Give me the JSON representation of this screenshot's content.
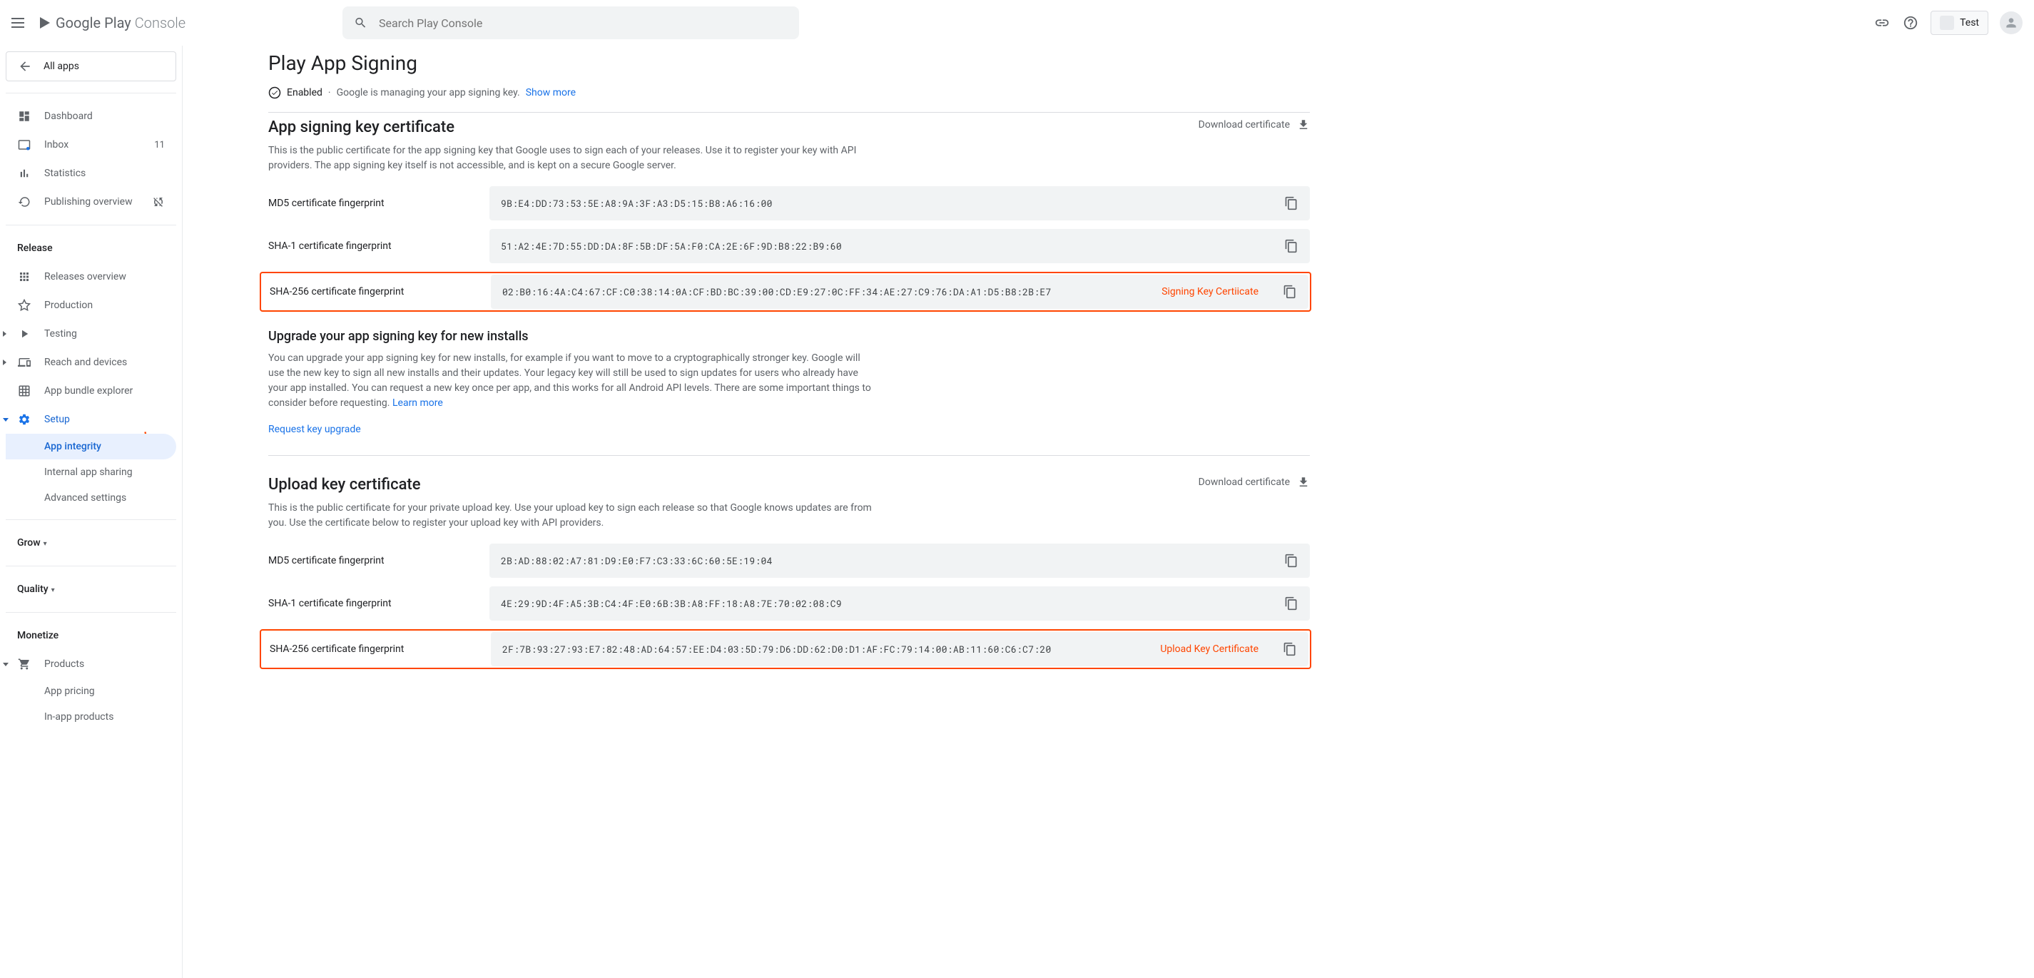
{
  "header": {
    "brand": "Google Play",
    "brand_suffix": "Console",
    "search_placeholder": "Search Play Console",
    "app_chip": "Test"
  },
  "sidebar": {
    "all_apps": "All apps",
    "items": [
      {
        "label": "Dashboard"
      },
      {
        "label": "Inbox",
        "badge": "11"
      },
      {
        "label": "Statistics"
      },
      {
        "label": "Publishing overview"
      }
    ],
    "release_heading": "Release",
    "release_items": [
      {
        "label": "Releases overview"
      },
      {
        "label": "Production"
      },
      {
        "label": "Testing"
      },
      {
        "label": "Reach and devices"
      },
      {
        "label": "App bundle explorer"
      },
      {
        "label": "Setup"
      }
    ],
    "setup_subitems": [
      {
        "label": "App integrity"
      },
      {
        "label": "Internal app sharing"
      },
      {
        "label": "Advanced settings"
      }
    ],
    "grow_heading": "Grow",
    "quality_heading": "Quality",
    "monetize_heading": "Monetize",
    "monetize_items": [
      {
        "label": "Products"
      }
    ],
    "monetize_subitems": [
      {
        "label": "App pricing"
      },
      {
        "label": "In-app products"
      }
    ]
  },
  "main": {
    "page_title": "Play App Signing",
    "status": {
      "enabled": "Enabled",
      "desc": "Google is managing your app signing key.",
      "show_more": "Show more"
    },
    "signing_section": {
      "title": "App signing key certificate",
      "desc": "This is the public certificate for the app signing key that Google uses to sign each of your releases. Use it to register your key with API providers. The app signing key itself is not accessible, and is kept on a secure Google server.",
      "download": "Download certificate",
      "fingerprints": [
        {
          "label": "MD5 certificate fingerprint",
          "value": "9B:E4:DD:73:53:5E:A8:9A:3F:A3:D5:15:B8:A6:16:00"
        },
        {
          "label": "SHA-1 certificate fingerprint",
          "value": "51:A2:4E:7D:55:DD:DA:8F:5B:DF:5A:F0:CA:2E:6F:9D:B8:22:B9:60"
        },
        {
          "label": "SHA-256 certificate fingerprint",
          "value": "02:B0:16:4A:C4:67:CF:C0:38:14:0A:CF:BD:BC:39:00:CD:E9:27:0C:FF:34:AE:27:C9:76:DA:A1:D5:B8:2B:E7"
        }
      ],
      "annotation": "Signing Key Certiicate"
    },
    "upgrade_section": {
      "title": "Upgrade your app signing key for new installs",
      "desc": "You can upgrade your app signing key for new installs, for example if you want to move to a cryptographically stronger key. Google will use the new key to sign all new installs and their updates. Your legacy key will still be used to sign updates for users who already have your app installed. You can request a new key once per app, and this works for all Android API levels. There are some important things to consider before requesting.",
      "learn_more": "Learn more",
      "request": "Request key upgrade"
    },
    "upload_section": {
      "title": "Upload key certificate",
      "desc": "This is the public certificate for your private upload key. Use your upload key to sign each release so that Google knows updates are from you. Use the certificate below to register your upload key with API providers.",
      "download": "Download certificate",
      "fingerprints": [
        {
          "label": "MD5 certificate fingerprint",
          "value": "2B:AD:88:02:A7:81:D9:E0:F7:C3:33:6C:60:5E:19:04"
        },
        {
          "label": "SHA-1 certificate fingerprint",
          "value": "4E:29:9D:4F:A5:3B:C4:4F:E0:6B:3B:A8:FF:18:A8:7E:70:02:08:C9"
        },
        {
          "label": "SHA-256 certificate fingerprint",
          "value": "2F:7B:93:27:93:E7:82:48:AD:64:57:EE:D4:03:5D:79:D6:DD:62:D0:D1:AF:FC:79:14:00:AB:11:60:C6:C7:20"
        }
      ],
      "annotation": "Upload Key Certificate"
    }
  }
}
